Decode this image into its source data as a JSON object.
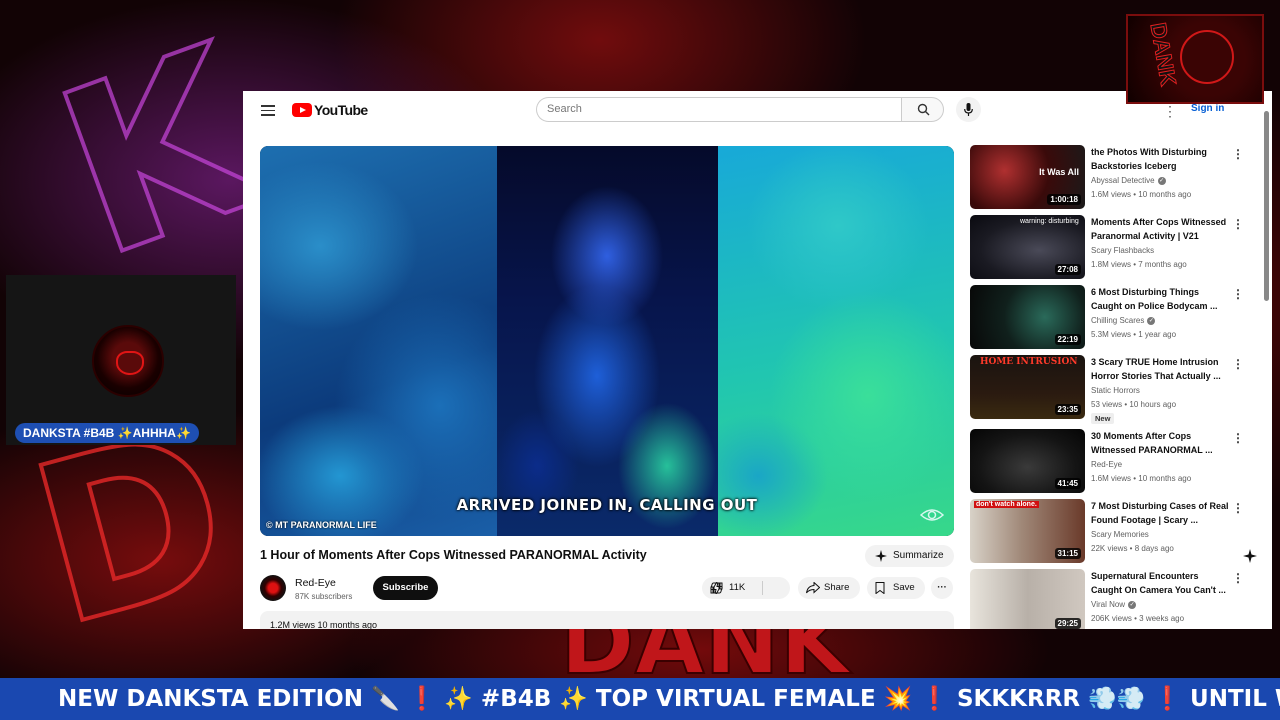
{
  "overlay": {
    "webcam_name": "DANKSTA #B4B ✨AHHHA✨",
    "ticker_text": "NEW DANKSTA EDITION 🔪 ❗ ✨ #B4B ✨ TOP VIRTUAL FEMALE 💥 ❗ SKKKRRR 💨💨 ❗ UNTIL W",
    "logo_text": "DANK",
    "backdrop_text": "DANK"
  },
  "youtube": {
    "logo_text": "YouTube",
    "search": {
      "placeholder": "Search"
    },
    "signin_label": "Sign in",
    "player": {
      "subtitle": "ARRIVED JOINED IN, CALLING OUT",
      "watermark": "© MT PARANORMAL LIFE"
    },
    "video": {
      "title": "1 Hour of Moments After Cops Witnessed PARANORMAL Activity",
      "summarize_label": "Summarize",
      "channel_name": "Red-Eye",
      "channel_subs": "87K subscribers",
      "subscribe_label": "Subscribe",
      "like_count": "11K",
      "share_label": "Share",
      "save_label": "Save",
      "meta": "1.2M views  10 months ago"
    },
    "recommendations": [
      {
        "title": "the Photos With Disturbing Backstories Iceberg",
        "channel": "Abyssal Detective",
        "verified": true,
        "meta": "1.6M views • 10 months ago",
        "duration": "1:00:18",
        "thumb_text": "It Was All"
      },
      {
        "title": "Moments After Cops Witnessed Paranormal Activity | V21",
        "channel": "Scary Flashbacks",
        "verified": false,
        "meta": "1.8M views • 7 months ago",
        "duration": "27:08",
        "thumb_text": "warning: disturbing"
      },
      {
        "title": "6 Most Disturbing Things Caught on Police Bodycam ...",
        "channel": "Chilling Scares",
        "verified": true,
        "meta": "5.3M views • 1 year ago",
        "duration": "22:19",
        "thumb_text": ""
      },
      {
        "title": "3 Scary TRUE Home Intrusion Horror Stories That Actually ...",
        "channel": "Static Horrors",
        "verified": false,
        "meta": "53 views • 10 hours ago",
        "duration": "23:35",
        "thumb_text": "HOME INTRUSION",
        "badge": "New"
      },
      {
        "title": "30 Moments After Cops Witnessed PARANORMAL ...",
        "channel": "Red-Eye",
        "verified": false,
        "meta": "1.6M views • 10 months ago",
        "duration": "41:45",
        "thumb_text": ""
      },
      {
        "title": "7 Most Disturbing Cases of Real Found Footage | Scary ...",
        "channel": "Scary Memories",
        "verified": false,
        "meta": "22K views • 8 days ago",
        "duration": "31:15",
        "thumb_text": "don't watch alone."
      },
      {
        "title": "Supernatural Encounters Caught On Camera You Can't ...",
        "channel": "Viral Now",
        "verified": true,
        "meta": "206K views • 3 weeks ago",
        "duration": "29:25",
        "thumb_text": ""
      }
    ]
  }
}
